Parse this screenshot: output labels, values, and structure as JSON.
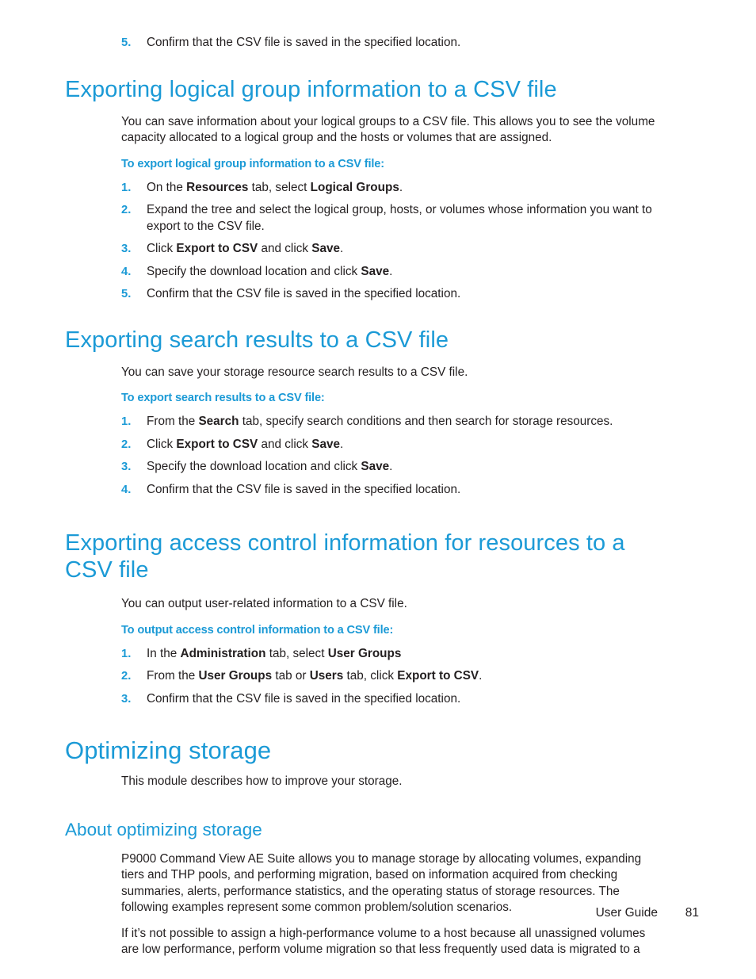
{
  "document": {
    "footer_label": "User Guide",
    "page_number": "81",
    "accent_color": "#1b9ad6",
    "text_color": "#231f20",
    "background_color": "#ffffff"
  },
  "carryover_step": {
    "num": "5.",
    "text": "Confirm that the CSV file is saved in the specified location."
  },
  "sections": [
    {
      "heading": "Exporting logical group information to a CSV file",
      "intro": "You can save information about your logical groups to a CSV file. This allows you to see the volume capacity allocated to a logical group and the hosts or volumes that are assigned.",
      "lead": "To export logical group information to a CSV file:",
      "steps": [
        {
          "num": "1.",
          "pre": "On the ",
          "b1": "Resources",
          "mid": " tab, select ",
          "b2": "Logical Groups",
          "post": "."
        },
        {
          "num": "2.",
          "pre": "Expand the tree and select the logical group, hosts, or volumes whose information you want to export to the CSV file.",
          "b1": "",
          "mid": "",
          "b2": "",
          "post": ""
        },
        {
          "num": "3.",
          "pre": "Click ",
          "b1": "Export to CSV",
          "mid": " and click ",
          "b2": "Save",
          "post": "."
        },
        {
          "num": "4.",
          "pre": "Specify the download location and click ",
          "b1": "Save",
          "mid": "",
          "b2": "",
          "post": "."
        },
        {
          "num": "5.",
          "pre": "Confirm that the CSV file is saved in the specified location.",
          "b1": "",
          "mid": "",
          "b2": "",
          "post": ""
        }
      ]
    },
    {
      "heading": "Exporting search results to a CSV file",
      "intro": "You can save your storage resource search results to a CSV file.",
      "lead": "To export search results to a CSV file:",
      "steps": [
        {
          "num": "1.",
          "pre": "From the ",
          "b1": "Search",
          "mid": " tab, specify search conditions and then search for storage resources.",
          "b2": "",
          "post": ""
        },
        {
          "num": "2.",
          "pre": "Click ",
          "b1": "Export to CSV",
          "mid": " and click ",
          "b2": "Save",
          "post": "."
        },
        {
          "num": "3.",
          "pre": "Specify the download location and click ",
          "b1": "Save",
          "mid": "",
          "b2": "",
          "post": "."
        },
        {
          "num": "4.",
          "pre": "Confirm that the CSV file is saved in the specified location.",
          "b1": "",
          "mid": "",
          "b2": "",
          "post": ""
        }
      ]
    },
    {
      "heading": "Exporting access control information for resources to a CSV file",
      "intro": "You can output user-related information to a CSV file.",
      "lead": "To output access control information to a CSV file:",
      "steps": [
        {
          "num": "1.",
          "pre": "In the ",
          "b1": "Administration",
          "mid": " tab, select ",
          "b2": "User Groups",
          "post": ""
        },
        {
          "num": "2.",
          "pre": "From the ",
          "b1": "User Groups",
          "mid": " tab or ",
          "b2": "Users",
          "post": " tab, click ",
          "b3": "Export to CSV",
          "post2": "."
        },
        {
          "num": "3.",
          "pre": "Confirm that the CSV file is saved in the specified location.",
          "b1": "",
          "mid": "",
          "b2": "",
          "post": ""
        }
      ]
    }
  ],
  "chapter": {
    "title": "Optimizing storage",
    "intro": "This module describes how to improve your storage.",
    "subsection": {
      "heading": "About optimizing storage",
      "paragraphs": [
        "P9000 Command View AE Suite allows you to manage storage by allocating volumes, expanding tiers and THP pools, and performing migration, based on information acquired from checking summaries, alerts, performance statistics, and the operating status of storage resources. The following examples represent some common problem/solution scenarios.",
        "If it’s not possible to assign a high-performance volume to a host because all unassigned volumes are low performance, perform volume migration so that less frequently used data is migrated to a"
      ]
    }
  }
}
